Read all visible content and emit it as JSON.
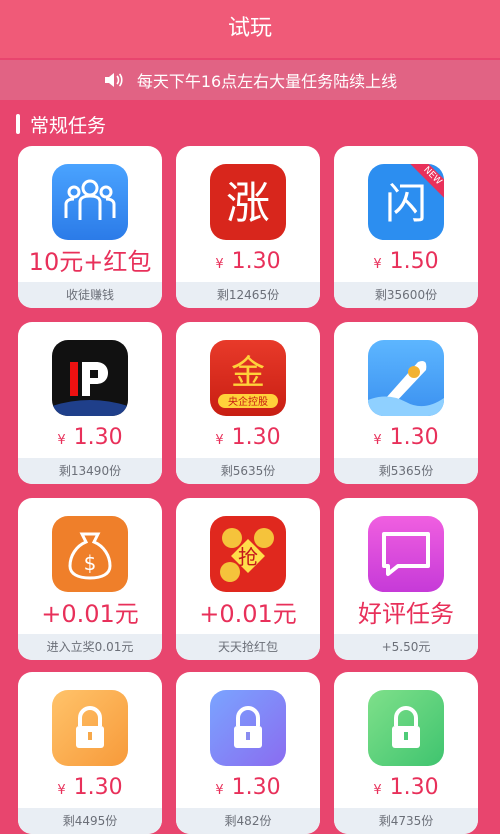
{
  "header": {
    "title": "试玩"
  },
  "notice": {
    "text": "每天下午16点左右大量任务陆续上线"
  },
  "section": {
    "title": "常规任务"
  },
  "cards": [
    {
      "icon": "people-icon",
      "price": "10元+红包",
      "foot": "收徒赚钱"
    },
    {
      "icon": "zhang-app-icon",
      "yen": "¥",
      "price": "1.30",
      "foot": "剩12465份"
    },
    {
      "icon": "shan-app-icon",
      "yen": "¥",
      "price": "1.50",
      "foot": "剩35600份",
      "badge": "NEW"
    },
    {
      "icon": "ip-app-icon",
      "yen": "¥",
      "price": "1.30",
      "foot": "剩13490份"
    },
    {
      "icon": "jin-app-icon",
      "yen": "¥",
      "price": "1.30",
      "foot": "剩5635份",
      "icon_text": "金",
      "icon_sub": "央企控股"
    },
    {
      "icon": "rocket-app-icon",
      "yen": "¥",
      "price": "1.30",
      "foot": "剩5365份"
    },
    {
      "icon": "money-bag-icon",
      "price": "+0.01元",
      "foot": "进入立奖0.01元"
    },
    {
      "icon": "red-packet-icon",
      "price": "+0.01元",
      "foot": "天天抢红包",
      "icon_text": "抢"
    },
    {
      "icon": "chat-icon",
      "price": "好评任务",
      "foot": "+5.50元"
    },
    {
      "icon": "lock-icon",
      "yen": "¥",
      "price": "1.30",
      "foot": "剩4495份"
    },
    {
      "icon": "lock-icon",
      "yen": "¥",
      "price": "1.30",
      "foot": "剩482份"
    },
    {
      "icon": "lock-icon",
      "yen": "¥",
      "price": "1.30",
      "foot": "剩4735份"
    }
  ],
  "colors": {
    "accent": "#e8305a",
    "background": "#e8456e",
    "header": "#f05a78"
  }
}
